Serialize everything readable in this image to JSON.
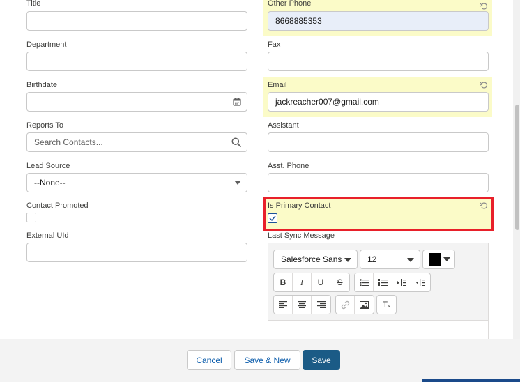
{
  "left_column": {
    "title_label": "Title",
    "department_label": "Department",
    "birthdate_label": "Birthdate",
    "reports_to_label": "Reports To",
    "reports_to_placeholder": "Search Contacts...",
    "lead_source_label": "Lead Source",
    "lead_source_value": "--None--",
    "contact_promoted_label": "Contact Promoted",
    "external_uid_label": "External UId"
  },
  "right_column": {
    "other_phone_label": "Other Phone",
    "other_phone_value": "8668885353",
    "fax_label": "Fax",
    "email_label": "Email",
    "email_value": "jackreacher007@gmail.com",
    "assistant_label": "Assistant",
    "asst_phone_label": "Asst. Phone",
    "is_primary_contact_label": "Is Primary Contact",
    "is_primary_contact_checked": true,
    "last_sync_message_label": "Last Sync Message"
  },
  "editor_toolbar": {
    "font_family": "Salesforce Sans",
    "font_size": "12",
    "text_color": "#000000",
    "bold": "B",
    "italic": "I",
    "underline": "U",
    "strike": "S",
    "clear_format": "T"
  },
  "footer": {
    "cancel_label": "Cancel",
    "save_new_label": "Save & New",
    "save_label": "Save"
  },
  "colors": {
    "highlight": "#fbfbc8",
    "red_outline": "#e8202a",
    "brand": "#1b5b86"
  }
}
